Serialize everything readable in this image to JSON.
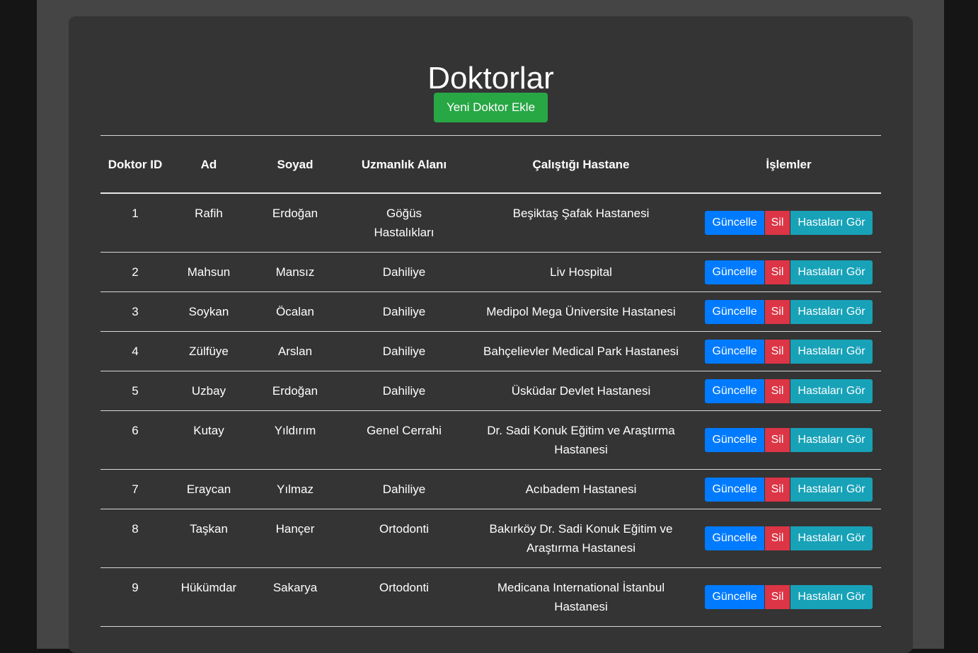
{
  "page": {
    "title": "Doktorlar",
    "add_button": "Yeni Doktor Ekle"
  },
  "table": {
    "headers": [
      "Doktor ID",
      "Ad",
      "Soyad",
      "Uzmanlık Alanı",
      "Çalıştığı Hastane",
      "İşlemler"
    ],
    "actions": {
      "update": "Güncelle",
      "delete": "Sil",
      "patients": "Hastaları Gör"
    },
    "rows": [
      {
        "id": "1",
        "first_name": "Rafih",
        "last_name": "Erdoğan",
        "specialty": "Göğüs Hastalıkları",
        "hospital": "Beşiktaş Şafak Hastanesi"
      },
      {
        "id": "2",
        "first_name": "Mahsun",
        "last_name": "Mansız",
        "specialty": "Dahiliye",
        "hospital": "Liv Hospital"
      },
      {
        "id": "3",
        "first_name": "Soykan",
        "last_name": "Öcalan",
        "specialty": "Dahiliye",
        "hospital": "Medipol Mega Üniversite Hastanesi"
      },
      {
        "id": "4",
        "first_name": "Zülfüye",
        "last_name": "Arslan",
        "specialty": "Dahiliye",
        "hospital": "Bahçelievler Medical Park Hastanesi"
      },
      {
        "id": "5",
        "first_name": "Uzbay",
        "last_name": "Erdoğan",
        "specialty": "Dahiliye",
        "hospital": "Üsküdar Devlet Hastanesi"
      },
      {
        "id": "6",
        "first_name": "Kutay",
        "last_name": "Yıldırım",
        "specialty": "Genel Cerrahi",
        "hospital": "Dr. Sadi Konuk Eğitim ve Araştırma Hastanesi"
      },
      {
        "id": "7",
        "first_name": "Eraycan",
        "last_name": "Yılmaz",
        "specialty": "Dahiliye",
        "hospital": "Acıbadem Hastanesi"
      },
      {
        "id": "8",
        "first_name": "Taşkan",
        "last_name": "Hançer",
        "specialty": "Ortodonti",
        "hospital": "Bakırköy Dr. Sadi Konuk Eğitim ve Araştırma Hastanesi"
      },
      {
        "id": "9",
        "first_name": "Hükümdar",
        "last_name": "Sakarya",
        "specialty": "Ortodonti",
        "hospital": "Medicana International İstanbul Hastanesi"
      }
    ]
  }
}
